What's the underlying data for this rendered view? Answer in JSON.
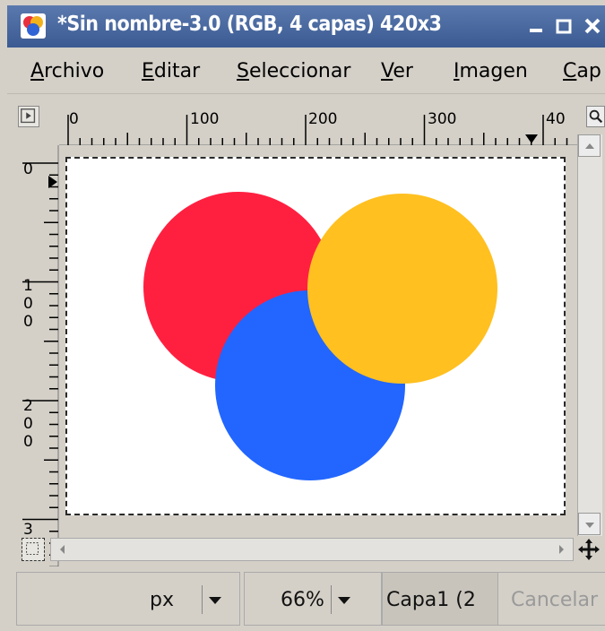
{
  "window": {
    "title": "*Sin nombre-3.0 (RGB, 4 capas) 420x3",
    "buttons": {
      "minimize": "minimize",
      "maximize": "maximize",
      "close": "close"
    }
  },
  "menu": {
    "items": [
      {
        "label": "Archivo",
        "mnemonic": "A"
      },
      {
        "label": "Editar",
        "mnemonic": "E"
      },
      {
        "label": "Seleccionar",
        "mnemonic": "S"
      },
      {
        "label": "Ver",
        "mnemonic": "V"
      },
      {
        "label": "Imagen",
        "mnemonic": "I"
      },
      {
        "label": "Cap",
        "mnemonic": "C"
      }
    ]
  },
  "rulers": {
    "horizontal_labels": [
      "0",
      "100",
      "200",
      "300",
      "40"
    ],
    "vertical_labels": [
      "0",
      "1\n0\n0",
      "2\n0\n0",
      "3"
    ]
  },
  "canvas": {
    "circles": [
      {
        "name": "red-circle",
        "color": "#ff2040"
      },
      {
        "name": "blue-circle",
        "color": "#2266ff"
      },
      {
        "name": "yellow-circle",
        "color": "#ffc020"
      }
    ],
    "background": "#ffffff"
  },
  "statusbar": {
    "unit": "px",
    "zoom": "66%",
    "layer": "Capa1 (2",
    "cancel": "Cancelar"
  },
  "icons": {
    "app": "gimp-icon",
    "nav_toggle": "menu-arrow-icon",
    "zoom_toggle": "zoom-icon",
    "quickmask": "quickmask-icon",
    "navigate": "move-cross-icon"
  }
}
